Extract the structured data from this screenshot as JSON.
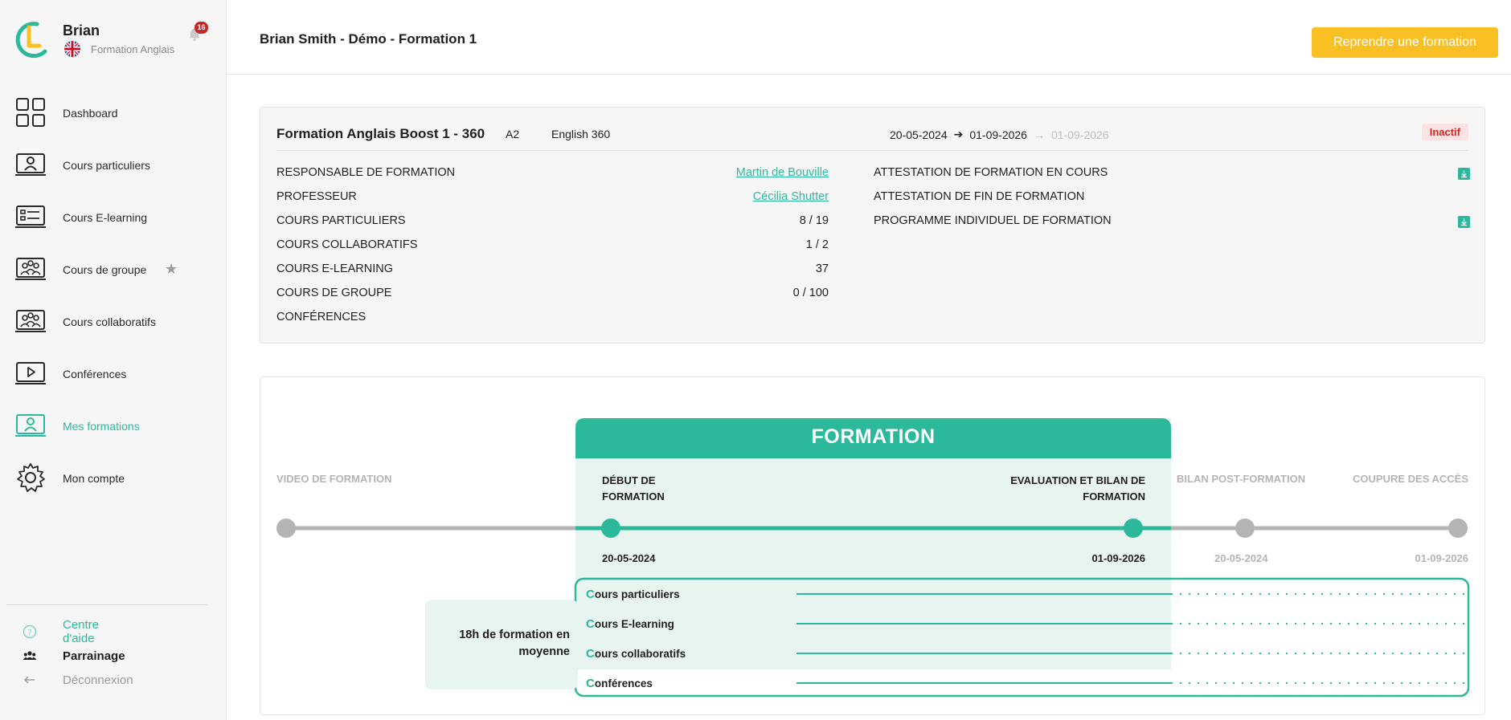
{
  "sidebar": {
    "user_name": "Brian",
    "user_course": "Formation Anglais",
    "notification_count": "16",
    "items": [
      {
        "label": "Dashboard",
        "icon": "dashboard-icon"
      },
      {
        "label": "Cours particuliers",
        "icon": "private-lesson-icon"
      },
      {
        "label": "Cours E-learning",
        "icon": "elearning-icon"
      },
      {
        "label": "Cours de groupe",
        "icon": "group-lesson-icon"
      },
      {
        "label": "Cours collaboratifs",
        "icon": "collaborative-icon"
      },
      {
        "label": "Conférences",
        "icon": "conference-icon"
      },
      {
        "label": "Mes formations",
        "icon": "my-trainings-icon",
        "active": true
      },
      {
        "label": "Mon compte",
        "icon": "gear-icon"
      }
    ],
    "bottom": {
      "help": "Centre d'aide",
      "referral": "Parrainage",
      "logout": "Déconnexion"
    }
  },
  "header": {
    "title": "Brian Smith - Démo - Formation 1",
    "resume_button": "Reprendre une formation"
  },
  "summary": {
    "course_name": "Formation Anglais Boost 1 - 360",
    "level": "A2",
    "program": "English 360",
    "date_start": "20-05-2024",
    "date_end": "01-09-2026",
    "date_extra": "01-09-2026",
    "status": "Inactif",
    "left_rows": [
      {
        "key": "RESPONSABLE DE FORMATION",
        "value": "Martin de Bouville"
      },
      {
        "key": "PROFESSEUR",
        "value": "Cécilia Shutter"
      },
      {
        "key": "COURS PARTICULIERS",
        "value": "8 / 19"
      },
      {
        "key": "COURS COLLABORATIFS",
        "value": "1 / 2"
      },
      {
        "key": "COURS E-LEARNING",
        "value": "37"
      },
      {
        "key": "COURS DE GROUPE",
        "value": "0 / 100"
      },
      {
        "key": "CONFÉRENCES",
        "value": ""
      }
    ],
    "right_rows": [
      {
        "key": "ATTESTATION DE FORMATION EN COURS"
      },
      {
        "key": "ATTESTATION DE FIN DE FORMATION"
      },
      {
        "key": "PROGRAMME INDIVIDUEL DE FORMATION"
      }
    ]
  },
  "timeline": {
    "formation_title": "FORMATION",
    "video": "VIDEO DE FORMATION",
    "start_label_1": "DÉBUT DE",
    "start_label_2": "FORMATION",
    "eval_label_1": "EVALUATION ET BILAN DE",
    "eval_label_2": "FORMATION",
    "post_label": "BILAN POST-FORMATION",
    "cut_label": "COUPURE DES ACCÈS",
    "start_date": "20-05-2024",
    "eval_date": "01-09-2026",
    "post_date": "20-05-2024",
    "cut_date": "01-09-2026",
    "avg_1": "18h de formation en",
    "avg_2": "moyenne",
    "activities": [
      {
        "cap": "C",
        "rest": "ours particuliers"
      },
      {
        "cap": "C",
        "rest": "ours E-learning"
      },
      {
        "cap": "C",
        "rest": "ours collaboratifs"
      },
      {
        "cap": "C",
        "rest": "onférences"
      }
    ]
  },
  "colors": {
    "accent": "#2bb89b",
    "button": "#f8c023",
    "status": "#c62828"
  }
}
